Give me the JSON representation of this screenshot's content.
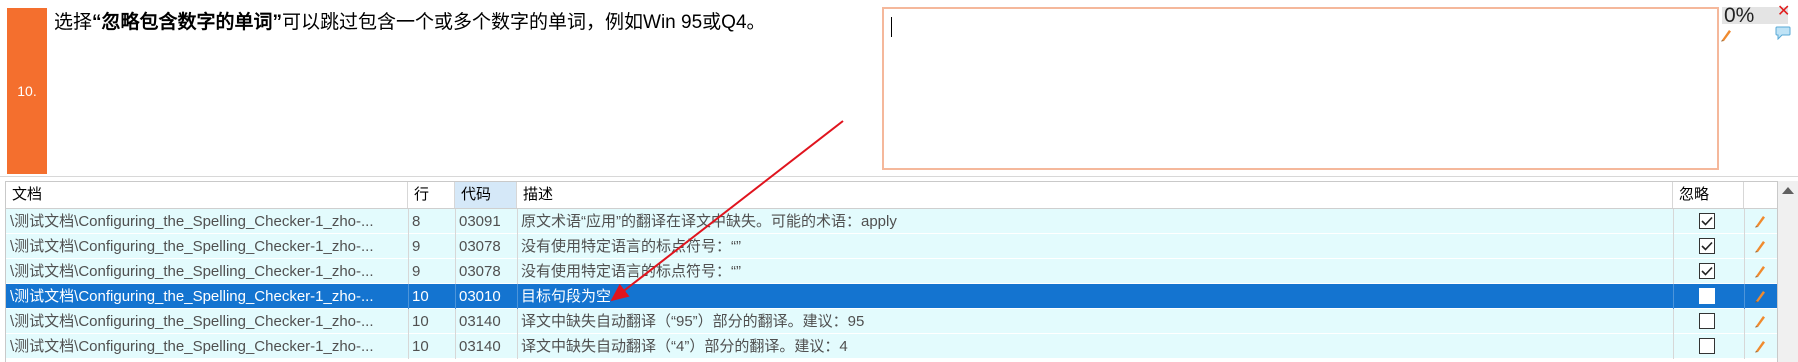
{
  "segment": {
    "number": "10.",
    "source_prefix": "选择",
    "source_bold": "“忽略包含数字的单词”",
    "source_suffix": "可以跳过包含一个或多个数字的单词，例如Win 95或Q4。",
    "target_text": "",
    "match_percent": "0%",
    "icons": [
      "pencil-icon",
      "close-icon",
      "comment-icon"
    ]
  },
  "colors": {
    "segment_number_bg": "#f46f2e",
    "target_border": "#f5b89b",
    "selected_row_bg": "#1474d0",
    "row_bg": "#e3fbfd",
    "arrow": "#e0141e"
  },
  "table": {
    "headers": {
      "document": "文档",
      "row": "行",
      "code": "代码",
      "description": "描述",
      "ignore": "忽略"
    },
    "rows": [
      {
        "document": "\\测试文档\\Configuring_the_Spelling_Checker-1_zho-...",
        "row": "8",
        "code": "03091",
        "description": "原文术语“应用”的翻译在译文中缺失。可能的术语：apply",
        "ignored": true,
        "selected": false
      },
      {
        "document": "\\测试文档\\Configuring_the_Spelling_Checker-1_zho-...",
        "row": "9",
        "code": "03078",
        "description": "没有使用特定语言的标点符号：“”",
        "ignored": true,
        "selected": false
      },
      {
        "document": "\\测试文档\\Configuring_the_Spelling_Checker-1_zho-...",
        "row": "9",
        "code": "03078",
        "description": "没有使用特定语言的标点符号：“”",
        "ignored": true,
        "selected": false
      },
      {
        "document": "\\测试文档\\Configuring_the_Spelling_Checker-1_zho-...",
        "row": "10",
        "code": "03010",
        "description": "目标句段为空",
        "ignored": false,
        "selected": true
      },
      {
        "document": "\\测试文档\\Configuring_the_Spelling_Checker-1_zho-...",
        "row": "10",
        "code": "03140",
        "description": "译文中缺失自动翻译（“95”）部分的翻译。建议：95",
        "ignored": false,
        "selected": false
      },
      {
        "document": "\\测试文档\\Configuring_the_Spelling_Checker-1_zho-...",
        "row": "10",
        "code": "03140",
        "description": "译文中缺失自动翻译（“4”）部分的翻译。建议：4",
        "ignored": false,
        "selected": false
      }
    ]
  }
}
